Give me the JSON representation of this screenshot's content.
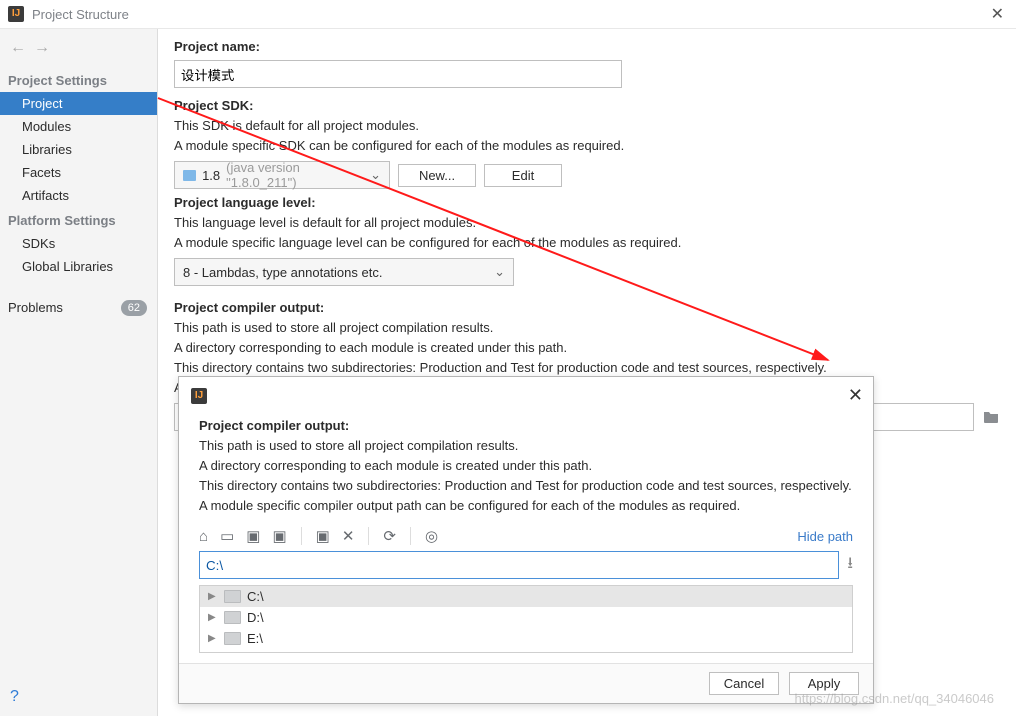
{
  "title": "Project Structure",
  "sidebar": {
    "sections": [
      {
        "header": "Project Settings",
        "items": [
          {
            "label": "Project",
            "selected": true
          },
          {
            "label": "Modules"
          },
          {
            "label": "Libraries"
          },
          {
            "label": "Facets"
          },
          {
            "label": "Artifacts"
          }
        ]
      },
      {
        "header": "Platform Settings",
        "items": [
          {
            "label": "SDKs"
          },
          {
            "label": "Global Libraries"
          }
        ]
      }
    ],
    "problems": {
      "label": "Problems",
      "badge": "62"
    }
  },
  "project": {
    "name_label": "Project name:",
    "name_value": "设计模式",
    "sdk_label": "Project SDK:",
    "sdk_desc1": "This SDK is default for all project modules.",
    "sdk_desc2": "A module specific SDK can be configured for each of the modules as required.",
    "sdk_selected": "1.8",
    "sdk_version": "(java version \"1.8.0_211\")",
    "new_btn": "New...",
    "edit_btn": "Edit",
    "lang_label": "Project language level:",
    "lang_desc1": "This language level is default for all project modules.",
    "lang_desc2": "A module specific language level can be configured for each of the modules as required.",
    "lang_selected": "8 - Lambdas, type annotations etc.",
    "out_label": "Project compiler output:",
    "out_desc1": "This path is used to store all project compilation results.",
    "out_desc2": "A directory corresponding to each module is created under this path.",
    "out_desc3": "This directory contains two subdirectories: Production and Test for production code and test sources, respectively.",
    "out_desc4": "A module specific compiler output path can be configured for each of the modules as required."
  },
  "popup": {
    "title": "Project compiler output:",
    "desc1": "This path is used to store all project compilation results.",
    "desc2": "A directory corresponding to each module is created under this path.",
    "desc3": "This directory contains two subdirectories: Production and Test for production code and test sources, respectively.",
    "desc4": "A module specific compiler output path can be configured for each of the modules as required.",
    "hide_path": "Hide path",
    "path": "C:\\",
    "drives": [
      "C:\\",
      "D:\\",
      "E:\\"
    ],
    "cancel": "Cancel",
    "apply": "Apply"
  },
  "watermark": "https://blog.csdn.net/qq_34046046"
}
